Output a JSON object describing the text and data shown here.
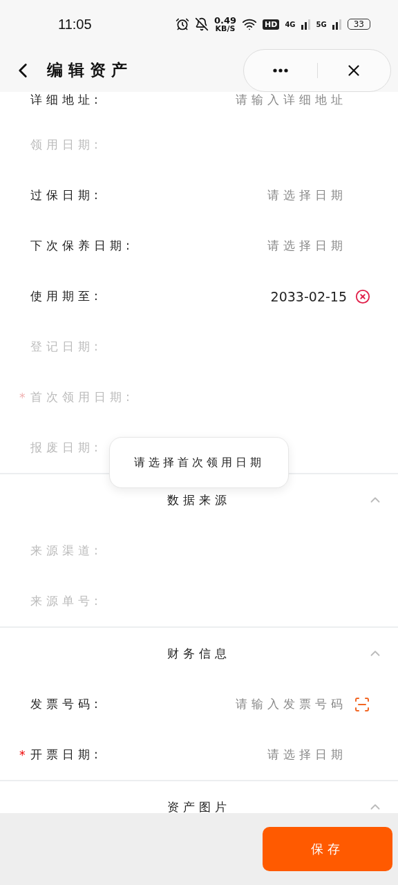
{
  "status_bar": {
    "time": "11:05",
    "speed": "0.49",
    "speed_unit": "KB/S",
    "hd": "HD",
    "net_1": "4G",
    "net_2": "5G",
    "battery": "33"
  },
  "header": {
    "title": "编辑资产"
  },
  "sections": [
    {
      "rows": [
        {
          "kind": "text",
          "label": "详细地址:",
          "disabled": false,
          "placeholder": "请输入详细地址"
        },
        {
          "label": "领用日期:",
          "disabled": true
        },
        {
          "kind": "date",
          "label": "过保日期:",
          "disabled": false,
          "placeholder": "请选择日期"
        },
        {
          "kind": "date",
          "label": "下次保养日期:",
          "disabled": false,
          "placeholder": "请选择日期"
        },
        {
          "kind": "date",
          "label": "使用期至:",
          "disabled": false,
          "value": "2033-02-15"
        },
        {
          "label": "登记日期:",
          "disabled": true
        },
        {
          "required_mark": "*",
          "label": "首次领用日期:",
          "disabled": true
        },
        {
          "label": "报废日期:",
          "disabled": true
        }
      ]
    },
    {
      "title": "数据来源",
      "expanded": true,
      "rows": [
        {
          "label": "来源渠道:",
          "disabled": true
        },
        {
          "label": "来源单号:",
          "disabled": true
        }
      ]
    },
    {
      "title": "财务信息",
      "expanded": true,
      "rows": [
        {
          "kind": "scan",
          "label": "发票号码:",
          "disabled": false,
          "placeholder": "请输入发票号码"
        },
        {
          "kind": "date",
          "required_mark": "*",
          "label": "开票日期:",
          "disabled": false,
          "placeholder": "请选择日期"
        }
      ]
    },
    {
      "title": "资产图片",
      "expanded": true
    }
  ],
  "toast": {
    "message": "请选择首次领用日期"
  },
  "footer": {
    "save_button": "保存"
  }
}
